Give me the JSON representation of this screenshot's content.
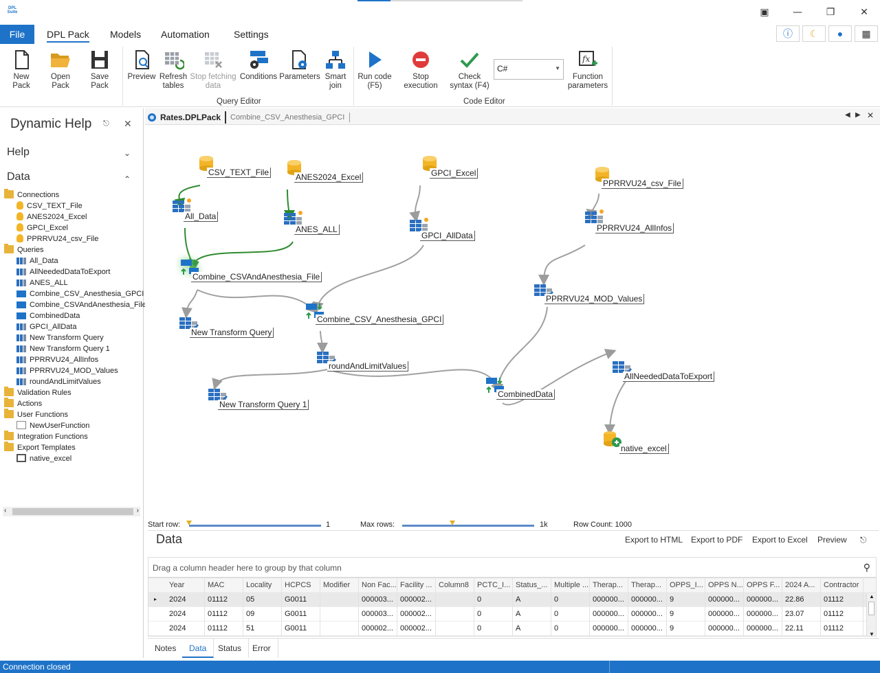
{
  "titlebar": {
    "logo": "DPL Suite"
  },
  "menu": {
    "tabs": [
      "File",
      "DPL Pack",
      "Models",
      "Automation",
      "Settings"
    ]
  },
  "ribbon": {
    "buttons": [
      {
        "label": "New Pack"
      },
      {
        "label": "Open Pack"
      },
      {
        "label": "Save Pack"
      },
      {
        "label": "Preview"
      },
      {
        "label": "Refresh tables"
      },
      {
        "label": "Stop fetching data",
        "disabled": true
      },
      {
        "label": "Conditions"
      },
      {
        "label": "Parameters"
      },
      {
        "label": "Smart join"
      },
      {
        "label": "Run code (F5)"
      },
      {
        "label": "Stop execution"
      },
      {
        "label": "Check syntax (F4)"
      },
      {
        "label": "Function parameters"
      }
    ],
    "language": "C#",
    "groups": {
      "query_editor": "Query Editor",
      "code_editor": "Code Editor"
    }
  },
  "left_panel": {
    "title": "Dynamic Help",
    "sections": {
      "help": "Help",
      "data": "Data"
    },
    "tree": [
      {
        "label": "Connections",
        "type": "folder",
        "level": 0
      },
      {
        "label": "CSV_TEXT_File",
        "type": "db",
        "level": 1
      },
      {
        "label": "ANES2024_Excel",
        "type": "db",
        "level": 1
      },
      {
        "label": "GPCI_Excel",
        "type": "db",
        "level": 1
      },
      {
        "label": "PPRRVU24_csv_File",
        "type": "db",
        "level": 1
      },
      {
        "label": "Queries",
        "type": "folder",
        "level": 0
      },
      {
        "label": "All_Data",
        "type": "q",
        "level": 1
      },
      {
        "label": "AllNeededDataToExport",
        "type": "q",
        "level": 1
      },
      {
        "label": "ANES_ALL",
        "type": "q",
        "level": 1
      },
      {
        "label": "Combine_CSV_Anesthesia_GPCI",
        "type": "qc",
        "level": 1
      },
      {
        "label": "Combine_CSVAndAnesthesia_File",
        "type": "qc",
        "level": 1
      },
      {
        "label": "CombinedData",
        "type": "qc",
        "level": 1
      },
      {
        "label": "GPCI_AllData",
        "type": "q",
        "level": 1
      },
      {
        "label": "New Transform Query",
        "type": "q",
        "level": 1
      },
      {
        "label": "New Transform Query 1",
        "type": "q",
        "level": 1
      },
      {
        "label": "PPRRVU24_AllInfos",
        "type": "q",
        "level": 1
      },
      {
        "label": "PPRRVU24_MOD_Values",
        "type": "q",
        "level": 1
      },
      {
        "label": "roundAndLimitValues",
        "type": "q",
        "level": 1
      },
      {
        "label": "Validation Rules",
        "type": "folder",
        "level": 0
      },
      {
        "label": "Actions",
        "type": "folder",
        "level": 0
      },
      {
        "label": "User Functions",
        "type": "folder",
        "level": 0
      },
      {
        "label": "NewUserFunction",
        "type": "fn",
        "level": 1
      },
      {
        "label": "Integration Functions",
        "type": "folder",
        "level": 0
      },
      {
        "label": "Export Templates",
        "type": "folder",
        "level": 0
      },
      {
        "label": "native_excel",
        "type": "ex",
        "level": 1
      }
    ]
  },
  "doc": {
    "active_tab": "Rates.DPLPack",
    "second_tab": "Combine_CSV_Anesthesia_GPCI"
  },
  "canvas_nodes": [
    {
      "id": "csv",
      "label": "CSV_TEXT_File",
      "kind": "db"
    },
    {
      "id": "anes",
      "label": "ANES2024_Excel",
      "kind": "db"
    },
    {
      "id": "gpci",
      "label": "GPCI_Excel",
      "kind": "db"
    },
    {
      "id": "pprr",
      "label": "PPRRVU24_csv_File",
      "kind": "db"
    },
    {
      "id": "alldata",
      "label": "All_Data",
      "kind": "q"
    },
    {
      "id": "anesall",
      "label": "ANES_ALL",
      "kind": "q"
    },
    {
      "id": "gpciall",
      "label": "GPCI_AllData",
      "kind": "q"
    },
    {
      "id": "pprrall",
      "label": "PPRRVU24_AllInfos",
      "kind": "q"
    },
    {
      "id": "comb1",
      "label": "Combine_CSVAndAnesthesia_File",
      "kind": "c"
    },
    {
      "id": "pprrmod",
      "label": "PPRRVU24_MOD_Values",
      "kind": "t"
    },
    {
      "id": "ntq",
      "label": "New Transform Query",
      "kind": "t"
    },
    {
      "id": "comb2",
      "label": "Combine_CSV_Anesthesia_GPCI",
      "kind": "c"
    },
    {
      "id": "round",
      "label": "roundAndLimitValues",
      "kind": "t"
    },
    {
      "id": "allneeded",
      "label": "AllNeededDataToExport",
      "kind": "t"
    },
    {
      "id": "combined",
      "label": "CombinedData",
      "kind": "c"
    },
    {
      "id": "ntq1",
      "label": "New Transform Query 1",
      "kind": "t"
    },
    {
      "id": "native",
      "label": "native_excel",
      "kind": "ex"
    }
  ],
  "sliders": {
    "start_row_label": "Start row:",
    "start_row": "1",
    "max_rows_label": "Max rows:",
    "max_rows": "1k",
    "row_count": "Row Count: 1000"
  },
  "data_panel": {
    "title": "Data",
    "links": [
      "Export to HTML",
      "Export to PDF",
      "Export to Excel",
      "Preview"
    ],
    "group_hint": "Drag a column header here to group by that column",
    "columns": [
      "Year",
      "MAC",
      "Locality",
      "HCPCS",
      "Modifier",
      "Non Fac...",
      "Facility ...",
      "Column8",
      "PCTC_I...",
      "Status_...",
      "Multiple ...",
      "Therap...",
      "Therap...",
      "OPPS_I...",
      "OPPS N...",
      "OPPS F...",
      "2024 A...",
      "Contractor"
    ],
    "rows": [
      [
        "2024",
        "01112",
        "05",
        "G0011",
        "",
        "000003...",
        "000002...",
        "",
        "0",
        "A",
        "0",
        "000000...",
        "000000...",
        "9",
        "000000...",
        "000000...",
        "22.86",
        "01112"
      ],
      [
        "2024",
        "01112",
        "09",
        "G0011",
        "",
        "000003...",
        "000002...",
        "",
        "0",
        "A",
        "0",
        "000000...",
        "000000...",
        "9",
        "000000...",
        "000000...",
        "23.07",
        "01112"
      ],
      [
        "2024",
        "01112",
        "51",
        "G0011",
        "",
        "000002...",
        "000002...",
        "",
        "0",
        "A",
        "0",
        "000000...",
        "000000...",
        "9",
        "000000...",
        "000000...",
        "22.11",
        "01112"
      ]
    ],
    "bottom_tabs": [
      "Notes",
      "Data",
      "Status",
      "Error"
    ]
  },
  "status": {
    "text": "Connection closed"
  },
  "colors": {
    "accent": "#1e73c8",
    "edge_active": "#2e8b2e",
    "edge": "#a0a0a0",
    "db": "#f3b527"
  }
}
